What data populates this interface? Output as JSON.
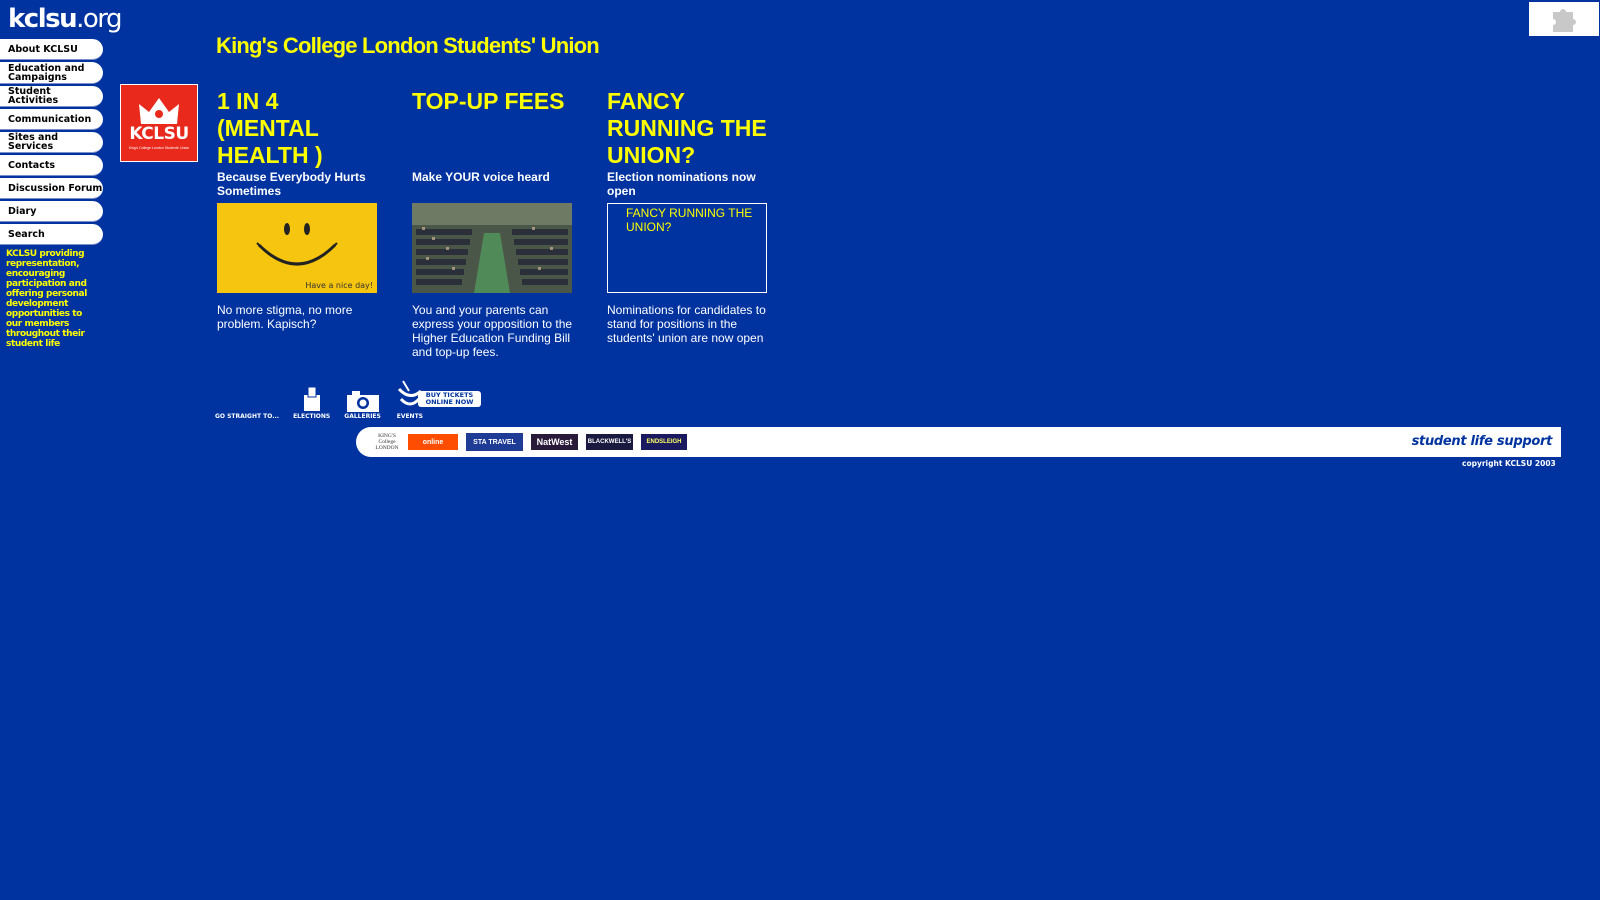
{
  "site": {
    "logo_main": "kclsu",
    "logo_tld": ".org",
    "page_title": "King's College London Students' Union"
  },
  "nav": {
    "items": [
      {
        "label": "About KCLSU",
        "name": "nav-about-kclsu"
      },
      {
        "label": "Education and Campaigns",
        "name": "nav-education-campaigns"
      },
      {
        "label": "Student Activities",
        "name": "nav-student-activities"
      },
      {
        "label": "Communication",
        "name": "nav-communication"
      },
      {
        "label": "Sites and Services",
        "name": "nav-sites-services"
      },
      {
        "label": "Contacts",
        "name": "nav-contacts"
      },
      {
        "label": "Discussion Forum",
        "name": "nav-discussion-forum"
      },
      {
        "label": "Diary",
        "name": "nav-diary"
      },
      {
        "label": "Search",
        "name": "nav-search"
      }
    ],
    "mission": "KCLSU providing representation, encouraging participation and offering personal development opportunities to our members throughout their student life"
  },
  "badge": {
    "text": "KCLSU",
    "sub": "King's College London Students' Union"
  },
  "stories": [
    {
      "headline": "1 IN 4 (MENTAL HEALTH )",
      "subhead": "Because Everybody Hurts Sometimes",
      "image_caption": "Have a nice day!",
      "body": "No more stigma, no more problem. Kapisch?"
    },
    {
      "headline": "TOP-UP FEES",
      "subhead": "Make YOUR voice heard",
      "body": "You and your parents can express your opposition to the Higher Education Funding Bill and top-up fees."
    },
    {
      "headline": "FANCY RUNNING THE UNION?",
      "subhead": "Election nominations now open",
      "image_alt": "FANCY RUNNING THE UNION?",
      "body": "Nominations for candidates to stand for positions in the students' union are now open"
    }
  ],
  "quicklinks": {
    "go_straight": "GO STRAIGHT TO...",
    "elections": "ELECTIONS",
    "galleries": "GALLERIES",
    "events": "EVENTS",
    "buy_tickets": "BUY TICKETS ONLINE NOW"
  },
  "sponsors": {
    "kings": "KING'S College LONDON",
    "online": "online",
    "sta": "STA TRAVEL",
    "natwest": "NatWest",
    "blackwells": "BLACKWELL'S",
    "endsleigh": "ENDSLEIGH",
    "tagline": "student life support"
  },
  "footer": {
    "copyright": "copyright KCLSU 2003"
  },
  "colors": {
    "background": "#0033a0",
    "accent_yellow": "#ffff00",
    "badge_red": "#e8291c"
  }
}
